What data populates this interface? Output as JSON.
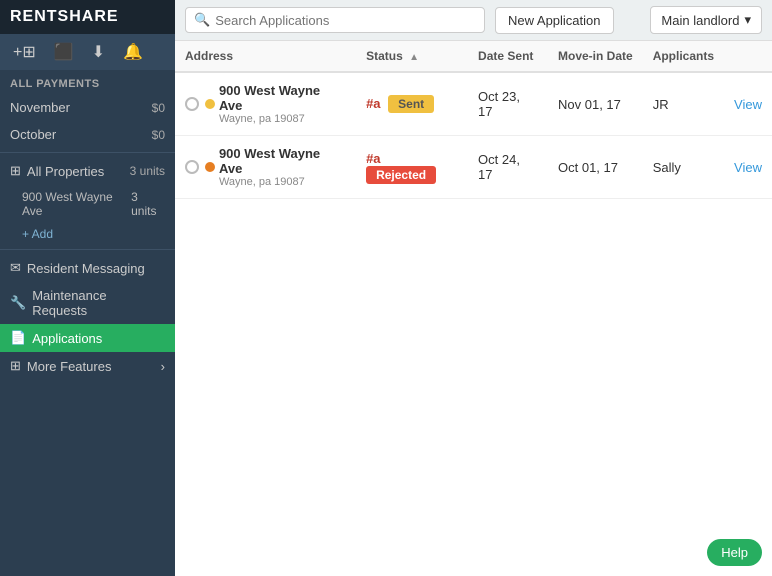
{
  "logo": "RENTSHARE",
  "toolbar": {
    "add_icon": "+⊞",
    "video_icon": "📷",
    "download_icon": "⬇",
    "bell_icon": "🔔"
  },
  "sidebar": {
    "all_payments_label": "All Payments",
    "november_label": "November",
    "november_amount": "$0",
    "october_label": "October",
    "october_amount": "$0",
    "all_properties_label": "All Properties",
    "all_properties_units": "3 units",
    "property_name": "900 West Wayne Ave",
    "property_units": "3 units",
    "add_link": "+ Add",
    "resident_messaging_label": "Resident Messaging",
    "maintenance_requests_label": "Maintenance Requests",
    "applications_label": "Applications",
    "more_features_label": "More Features"
  },
  "topbar": {
    "search_placeholder": "Search Applications",
    "new_application_label": "New Application",
    "landlord_label": "Main landlord",
    "search_icon": "🔍"
  },
  "table": {
    "columns": [
      "Address",
      "Status",
      "Date Sent",
      "Move-in Date",
      "Applicants",
      ""
    ],
    "rows": [
      {
        "indicator_class": "yellow",
        "address_main": "900 West Wayne Ave",
        "address_sub": "Wayne, pa 19087",
        "unit": "#a",
        "status": "Sent",
        "status_class": "sent",
        "date_sent": "Oct 23, 17",
        "move_in_date": "Nov 01, 17",
        "applicants": "JR",
        "view_label": "View"
      },
      {
        "indicator_class": "orange",
        "address_main": "900 West Wayne Ave",
        "address_sub": "Wayne, pa 19087",
        "unit": "#a",
        "status": "Rejected",
        "status_class": "rejected",
        "date_sent": "Oct 24, 17",
        "move_in_date": "Oct 01, 17",
        "applicants": "Sally",
        "view_label": "View"
      }
    ]
  },
  "help_label": "Help"
}
